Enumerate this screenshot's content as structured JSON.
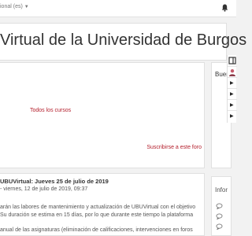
{
  "navbar": {
    "language": "ional (es)",
    "language_caret": "▼"
  },
  "header": {
    "site_title": "Virtual de la Universidad de Burgos"
  },
  "main": {
    "all_courses_link": "Todos los cursos",
    "subscribe_link": "Suscribirse a este foro"
  },
  "news": {
    "post_title": "UBUVirtual: Jueves 25 de julio de 2019",
    "post_meta": "- viernes, 12 de julio de 2019, 09:37",
    "body_lines": [
      "arán las labores de mantenimiento y actualización de UBUVirtual con el objetivo",
      "Su duración se estima en 15 días, por lo que durante este tiempo la plataforma",
      "anual de las asignaturas (eliminación de calificaciones, intervenciones en foros"
    ]
  },
  "sidebar": {
    "block1_title": "Buen",
    "block2_title": "Infor"
  },
  "drawer": {
    "arrow": "▶"
  },
  "colors": {
    "link": "#b31d2a",
    "background": "#f2f2f2"
  },
  "icons": [
    "bell-icon",
    "chevron-down-icon",
    "drawer-toggle-icon",
    "avatar-icon",
    "chevron-right-icon",
    "chat-icon"
  ]
}
